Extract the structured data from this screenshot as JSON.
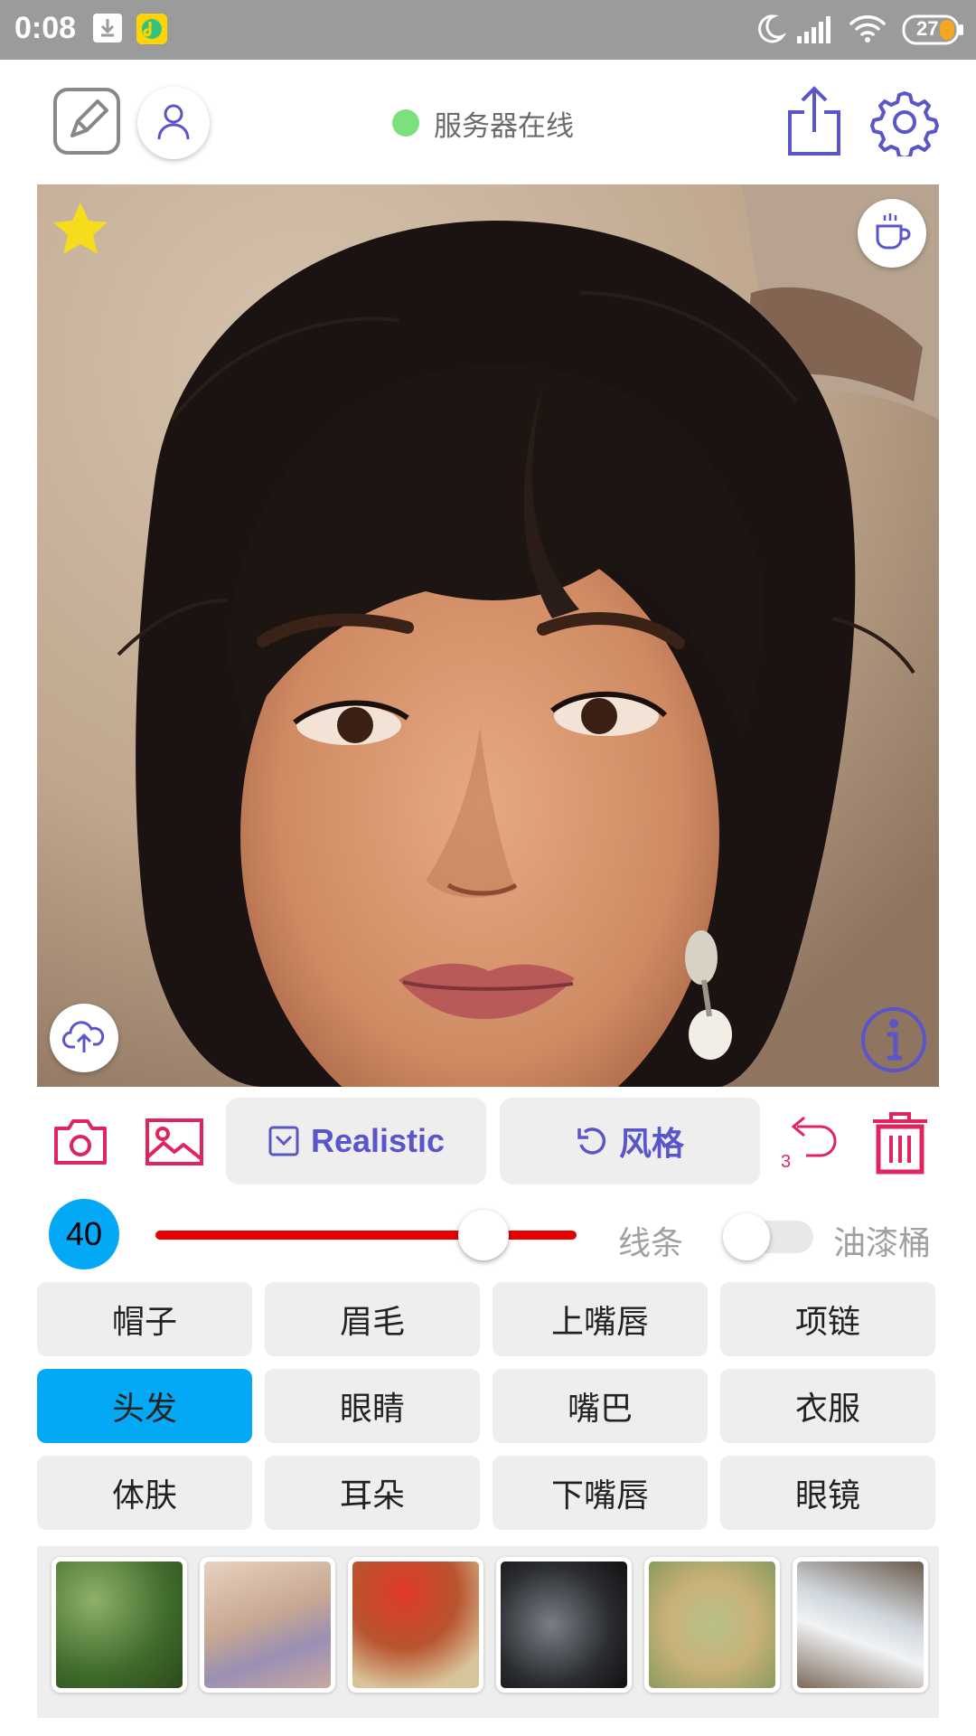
{
  "status_bar": {
    "time": "0:08",
    "battery": "27",
    "icons": [
      "download-icon",
      "music-app-icon",
      "moon-icon",
      "signal-icon",
      "wifi-icon",
      "battery-icon"
    ]
  },
  "header": {
    "server_status": "服务器在线",
    "status_color": "#7ce07c",
    "icons": [
      "sketch-icon",
      "user-icon",
      "share-icon",
      "gear-icon"
    ]
  },
  "photo": {
    "overlay_icons": [
      "star-icon",
      "coffee-icon",
      "upload-icon",
      "info-icon"
    ]
  },
  "toolbar": {
    "realistic_label": "Realistic",
    "style_label": "风格",
    "undo_count": "3",
    "icons": [
      "camera-icon",
      "image-icon",
      "checkbox-icon",
      "refresh-icon",
      "undo-icon",
      "trash-icon"
    ]
  },
  "brush": {
    "size": "40",
    "line_label": "线条",
    "bucket_label": "油漆桶",
    "slider_level": 0.78,
    "bucket_enabled": false
  },
  "categories": [
    {
      "label": "帽子",
      "active": false
    },
    {
      "label": "眉毛",
      "active": false
    },
    {
      "label": "上嘴唇",
      "active": false
    },
    {
      "label": "项链",
      "active": false
    },
    {
      "label": "头发",
      "active": true
    },
    {
      "label": "眼睛",
      "active": false
    },
    {
      "label": "嘴巴",
      "active": false
    },
    {
      "label": "衣服",
      "active": false
    },
    {
      "label": "体肤",
      "active": false
    },
    {
      "label": "耳朵",
      "active": false
    },
    {
      "label": "下嘴唇",
      "active": false
    },
    {
      "label": "眼镜",
      "active": false
    }
  ],
  "colors": {
    "accent_blue": "#03a9f4",
    "accent_purple": "#5a55c8",
    "accent_pink": "#e0245e",
    "slider_red": "#e60000"
  }
}
